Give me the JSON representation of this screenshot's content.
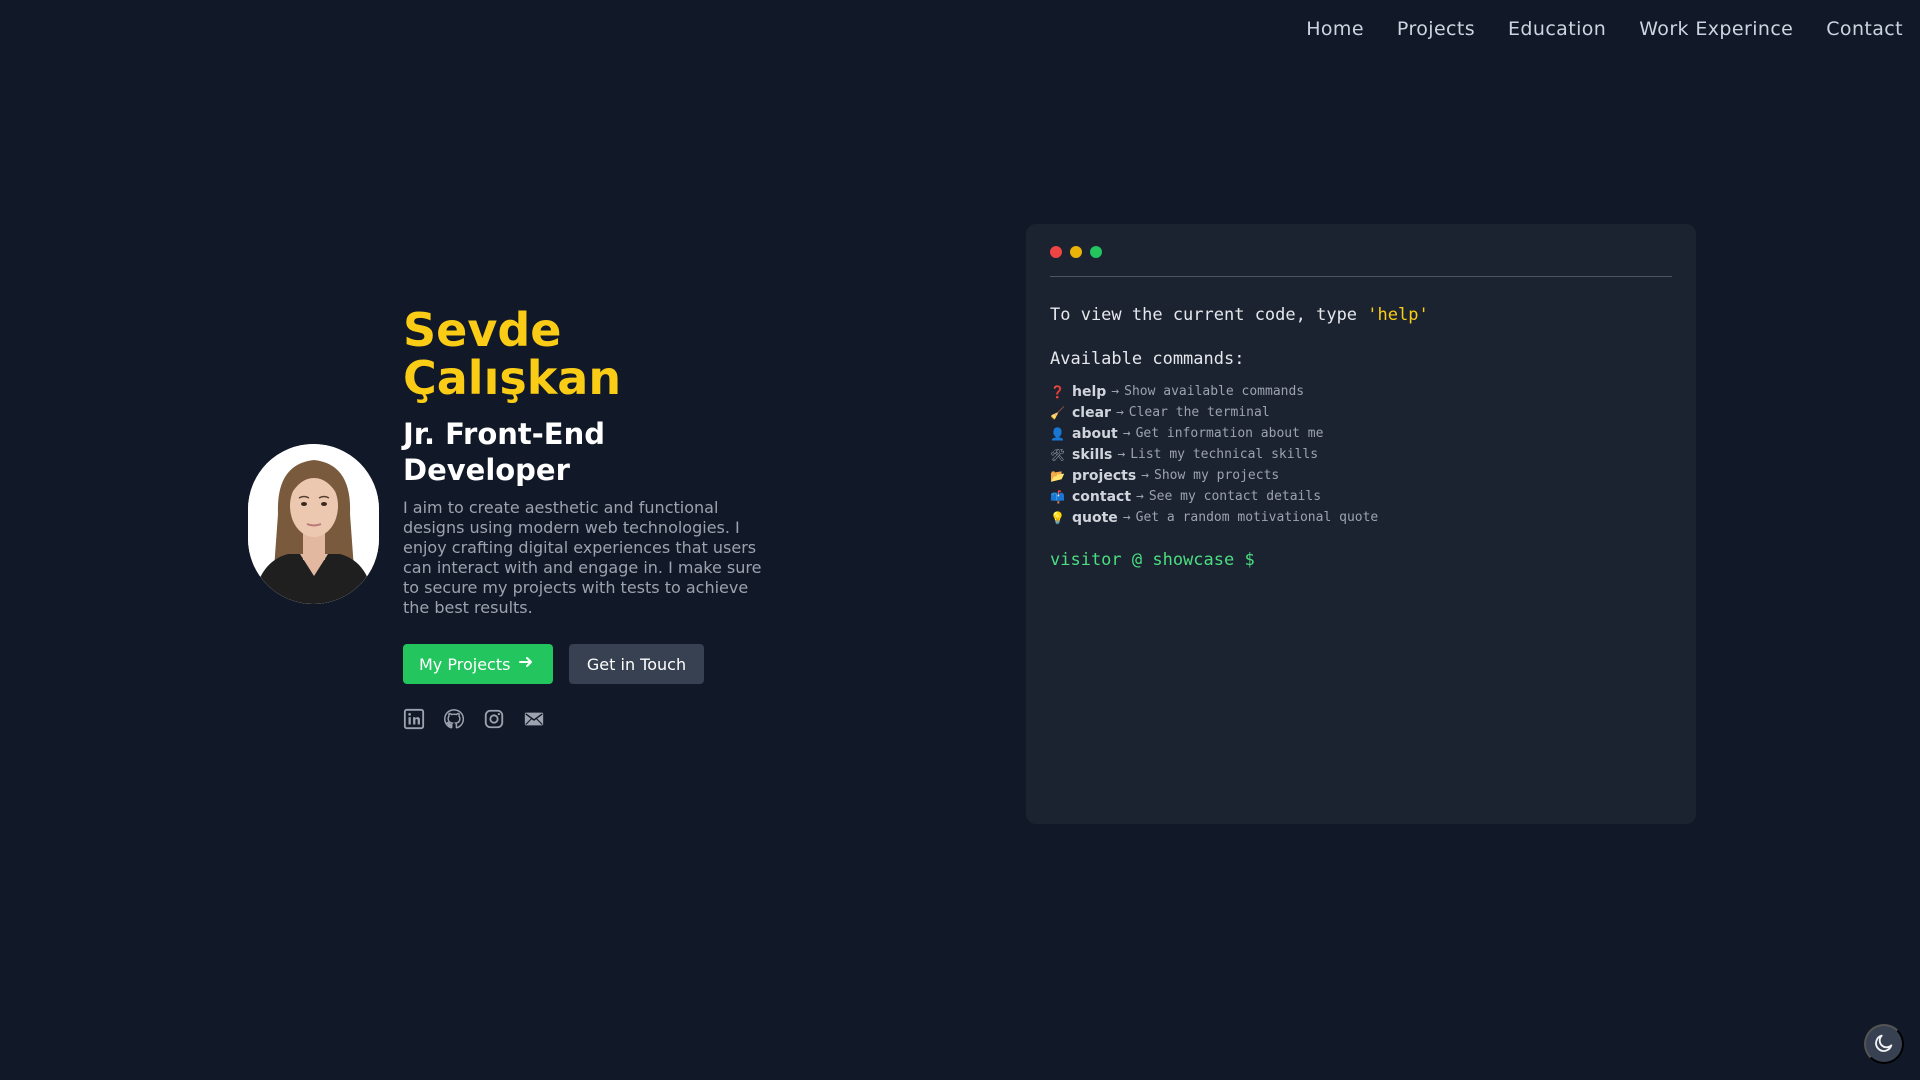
{
  "nav": {
    "items": [
      "Home",
      "Projects",
      "Education",
      "Work Experince",
      "Contact"
    ]
  },
  "profile": {
    "name": "Sevde Çalışkan",
    "role": "Jr. Front-End Developer",
    "bio": "I aim to create aesthetic and functional designs using modern web technologies. I enjoy crafting digital experiences that users can interact with and engage in. I make sure to secure my projects with tests to achieve the best results.",
    "primary_button": "My Projects",
    "secondary_button": "Get in Touch",
    "socials": [
      "linkedin-icon",
      "github-icon",
      "instagram-icon",
      "mail-icon"
    ]
  },
  "terminal": {
    "dot_colors": [
      "#ef4444",
      "#eab308",
      "#22c55e"
    ],
    "intro_text": "To view the current code, type ",
    "intro_highlight": "'help'",
    "commands_title": "Available commands:",
    "arrow": "→",
    "commands": [
      {
        "emoji": "❓",
        "name": "help",
        "desc": "Show available commands"
      },
      {
        "emoji": "🧹",
        "name": "clear",
        "desc": "Clear the terminal"
      },
      {
        "emoji": "👤",
        "name": "about",
        "desc": "Get information about me"
      },
      {
        "emoji": "🛠",
        "name": "skills",
        "desc": "List my technical skills"
      },
      {
        "emoji": "📂",
        "name": "projects",
        "desc": "Show my projects"
      },
      {
        "emoji": "📫",
        "name": "contact",
        "desc": "See my contact details"
      },
      {
        "emoji": "💡",
        "name": "quote",
        "desc": "Get a random motivational quote"
      }
    ],
    "prompt": "visitor @ showcase $"
  },
  "theme_toggle": {
    "icon": "moon-icon"
  },
  "colors": {
    "background": "#111827",
    "accent_name": "#facc15",
    "primary_button": "#22c55e",
    "secondary_button": "#374151",
    "terminal_bg": "#1b2230",
    "prompt": "#4ade80"
  }
}
